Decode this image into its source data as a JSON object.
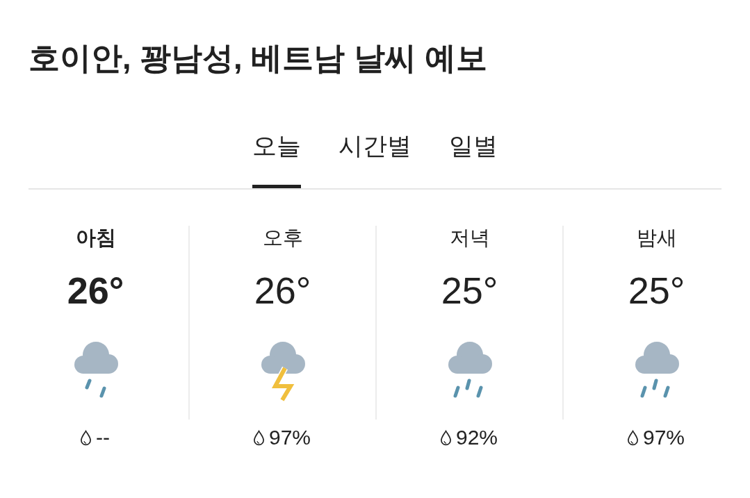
{
  "title": "호이안, 꽝남성, 베트남 날씨 예보",
  "tabs": [
    {
      "label": "오늘",
      "selected": true
    },
    {
      "label": "시간별",
      "selected": false
    },
    {
      "label": "일별",
      "selected": false
    }
  ],
  "periods": [
    {
      "name": "아침",
      "selected": true,
      "temperature": "26°",
      "kind": "light-rain",
      "precipitation": "--"
    },
    {
      "name": "오후",
      "selected": false,
      "temperature": "26°",
      "kind": "thunderstorm",
      "precipitation": "97%"
    },
    {
      "name": "저녁",
      "selected": false,
      "temperature": "25°",
      "kind": "rain",
      "precipitation": "92%"
    },
    {
      "name": "밤새",
      "selected": false,
      "temperature": "25°",
      "kind": "rain",
      "precipitation": "97%"
    }
  ]
}
